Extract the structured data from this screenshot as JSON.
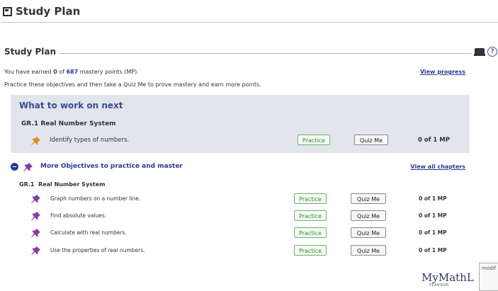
{
  "window": {
    "title": "Study Plan"
  },
  "section": {
    "title": "Study Plan"
  },
  "info": {
    "earned_prefix": "You have earned ",
    "earned_points": "0",
    "earned_of": " of ",
    "total_points": "687",
    "earned_suffix": " mastery points (MP).",
    "instructions": "Practice these objectives and then take a Quiz Me to prove mastery and earn more points.",
    "view_progress": "View progress"
  },
  "next": {
    "title": "What to work on next",
    "objective_code": "GR.1",
    "objective_name": "Real Number System",
    "item": {
      "label": "Identify types of numbers.",
      "practice": "Practice",
      "quiz": "Quiz Me",
      "mp": "0 of 1 MP"
    }
  },
  "more": {
    "title": "More Objectives to practice and master",
    "view_all": "View all chapters",
    "objective_code": "GR.1",
    "objective_name": "Real Number System",
    "items": [
      {
        "label": "Graph numbers on a number line.",
        "practice": "Practice",
        "quiz": "Quiz Me",
        "mp": "0 of 1 MP"
      },
      {
        "label": "Find absolute values.",
        "practice": "Practice",
        "quiz": "Quiz Me",
        "mp": "0 of 1 MP"
      },
      {
        "label": "Calculate with real numbers.",
        "practice": "Practice",
        "quiz": "Quiz Me",
        "mp": "0 of 1 MP"
      },
      {
        "label": "Use the properties of real numbers.",
        "practice": "Practice",
        "quiz": "Quiz Me",
        "mp": "0 of 1 MP"
      }
    ]
  },
  "footer": {
    "brand": "MyMathL",
    "brand_sub": "PEARSON",
    "modal_peek": "modif"
  },
  "colors": {
    "accent": "#2a3a9a",
    "practice_green": "#2f8a2f",
    "next_box_bg": "#e3e5ec",
    "pin_orange": "#e58a1f",
    "pin_purple": "#8a3aa8"
  },
  "icons": [
    "window-icon",
    "print-icon",
    "help-icon",
    "pushpin-icon",
    "collapse-icon"
  ]
}
